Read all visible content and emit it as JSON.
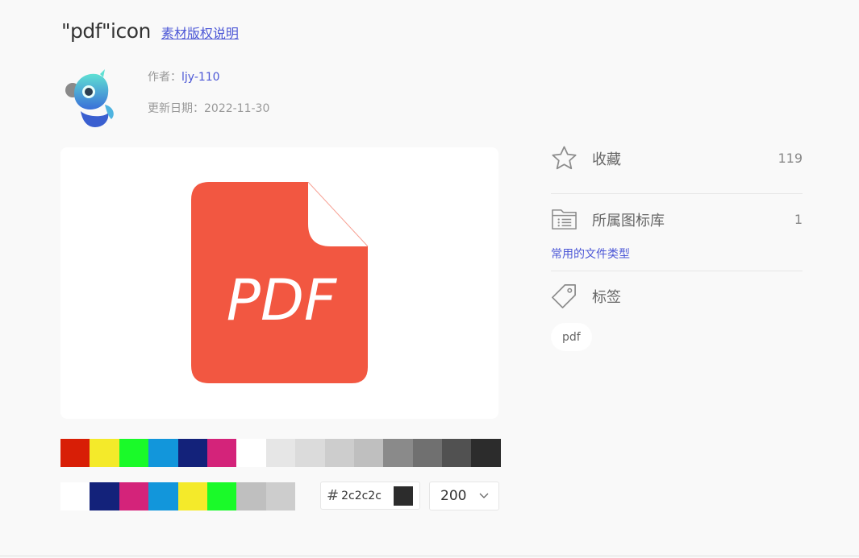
{
  "header": {
    "title": "\"pdf\"icon",
    "copyright_link": "素材版权说明"
  },
  "meta": {
    "author_label": "作者：",
    "author_name": "ljy-110",
    "date_label": "更新日期：",
    "date_value": "2022-11-30"
  },
  "preview": {
    "icon_text": "PDF",
    "icon_color": "#f25741"
  },
  "palette_main": [
    "#d81e06",
    "#f4ea2a",
    "#1afa29",
    "#1296db",
    "#13227a",
    "#d4237a",
    "#ffffff",
    "#e6e6e6",
    "#dbdbdb",
    "#cdcdcd",
    "#bfbfbf",
    "#8a8a8a",
    "#707070",
    "#515151",
    "#2c2c2c"
  ],
  "palette_recent": [
    "#ffffff",
    "#13227a",
    "#d4237a",
    "#1296db",
    "#f4ea2a",
    "#1afa29",
    "#bfbfbf",
    "#cdcdcd"
  ],
  "color_input": {
    "hash": "#",
    "value": "2c2c2c",
    "chip_color": "#2c2c2c"
  },
  "size_select": {
    "value": "200"
  },
  "sidebar": {
    "favorite": {
      "label": "收藏",
      "count": "119",
      "icon": "star-icon"
    },
    "library": {
      "label": "所属图标库",
      "count": "1",
      "icon": "folder-list-icon",
      "link": "常用的文件类型"
    },
    "tags": {
      "label": "标签",
      "icon": "tag-icon",
      "items": [
        "pdf"
      ]
    }
  }
}
